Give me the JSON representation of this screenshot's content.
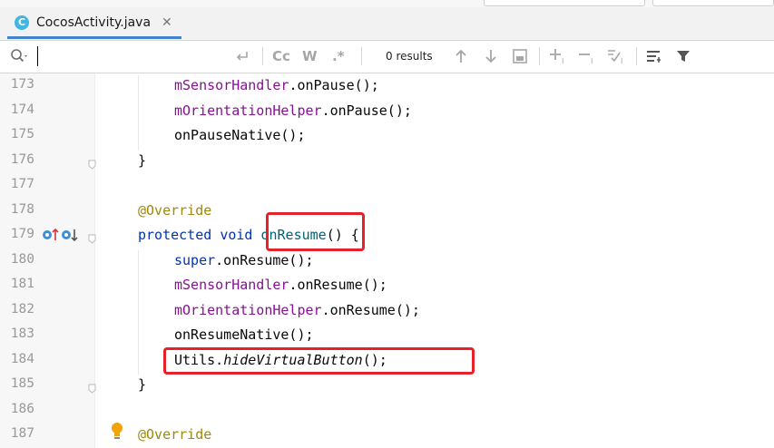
{
  "tabs": {
    "active": {
      "icon": "C",
      "title": "CocosActivity.java",
      "close": "✕"
    }
  },
  "findbar": {
    "search_value": "",
    "match_case": "Cc",
    "words": "W",
    "regex": ".*",
    "results": "0 results"
  },
  "editor": {
    "lines": [
      {
        "num": "173",
        "indent": 1,
        "tokens": [
          {
            "t": "mSensorHandler",
            "c": "purple"
          },
          {
            "t": ".onPause();",
            "c": "plain"
          }
        ]
      },
      {
        "num": "174",
        "indent": 1,
        "tokens": [
          {
            "t": "mOrientationHelper",
            "c": "purple"
          },
          {
            "t": ".onPause();",
            "c": "plain"
          }
        ]
      },
      {
        "num": "175",
        "indent": 1,
        "tokens": [
          {
            "t": "onPauseNative();",
            "c": "plain"
          }
        ]
      },
      {
        "num": "176",
        "indent": 0,
        "tokens": [
          {
            "t": "}",
            "c": "plain"
          }
        ]
      },
      {
        "num": "177",
        "indent": 0,
        "tokens": []
      },
      {
        "num": "178",
        "indent": 0,
        "tokens": [
          {
            "t": "@Override",
            "c": "anno"
          }
        ]
      },
      {
        "num": "179",
        "indent": 0,
        "tokens": [
          {
            "t": "protected",
            "c": "blue"
          },
          {
            "t": " ",
            "c": "plain"
          },
          {
            "t": "void",
            "c": "blue"
          },
          {
            "t": " ",
            "c": "plain"
          },
          {
            "t": "onResume",
            "c": "method"
          },
          {
            "t": "() {",
            "c": "plain"
          }
        ]
      },
      {
        "num": "180",
        "indent": 1,
        "tokens": [
          {
            "t": "super",
            "c": "blue"
          },
          {
            "t": ".onResume();",
            "c": "plain"
          }
        ]
      },
      {
        "num": "181",
        "indent": 1,
        "tokens": [
          {
            "t": "mSensorHandler",
            "c": "purple"
          },
          {
            "t": ".onResume();",
            "c": "plain"
          }
        ]
      },
      {
        "num": "182",
        "indent": 1,
        "tokens": [
          {
            "t": "mOrientationHelper",
            "c": "purple"
          },
          {
            "t": ".onResume();",
            "c": "plain"
          }
        ]
      },
      {
        "num": "183",
        "indent": 1,
        "tokens": [
          {
            "t": "onResumeNative();",
            "c": "plain"
          }
        ]
      },
      {
        "num": "184",
        "indent": 1,
        "tokens": [
          {
            "t": "Utils.",
            "c": "plain"
          },
          {
            "t": "hideVirtualButton",
            "c": "italic"
          },
          {
            "t": "();",
            "c": "plain"
          }
        ]
      },
      {
        "num": "185",
        "indent": 0,
        "tokens": [
          {
            "t": "}",
            "c": "plain"
          }
        ]
      },
      {
        "num": "186",
        "indent": 0,
        "tokens": []
      },
      {
        "num": "187",
        "indent": 0,
        "tokens": [
          {
            "t": "@Override",
            "c": "anno"
          }
        ]
      }
    ]
  },
  "colors": {
    "accent": "#4083c9",
    "highlight_box": "#e8202a",
    "keyword": "#0033b3",
    "field": "#871094",
    "annotation": "#9e880d",
    "method_decl": "#00627a"
  }
}
